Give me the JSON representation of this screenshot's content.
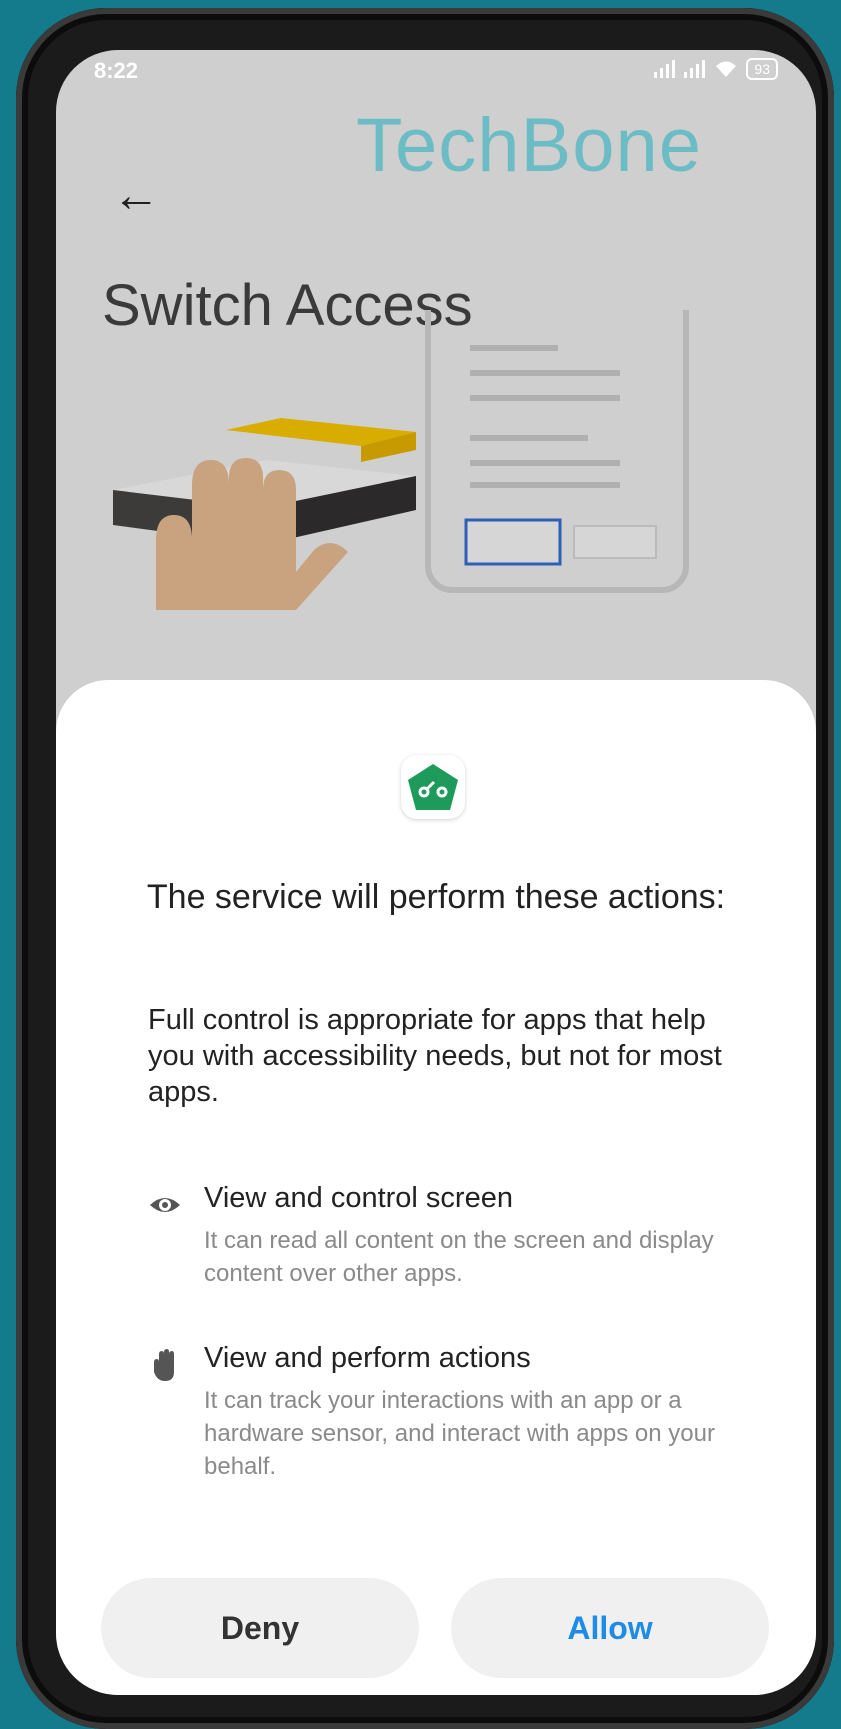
{
  "status_bar": {
    "time": "8:22",
    "battery": "93"
  },
  "watermark": "TechBone",
  "header": {
    "title": "Switch Access"
  },
  "dialog": {
    "title": "The service will perform these actions:",
    "description": "Full control is appropriate for apps that help you with accessibility needs, but not for most apps.",
    "permissions": [
      {
        "icon": "eye-icon",
        "title": "View and control screen",
        "description": "It can read all content on the screen and display content over other apps."
      },
      {
        "icon": "hand-icon",
        "title": "View and perform actions",
        "description": "It can track your interactions with an app or a hardware sensor, and interact with apps on your behalf."
      }
    ],
    "deny_label": "Deny",
    "allow_label": "Allow"
  },
  "colors": {
    "accent": "#1e8ce6",
    "app_icon": "#1e9b5a",
    "background": "#137b8c"
  }
}
